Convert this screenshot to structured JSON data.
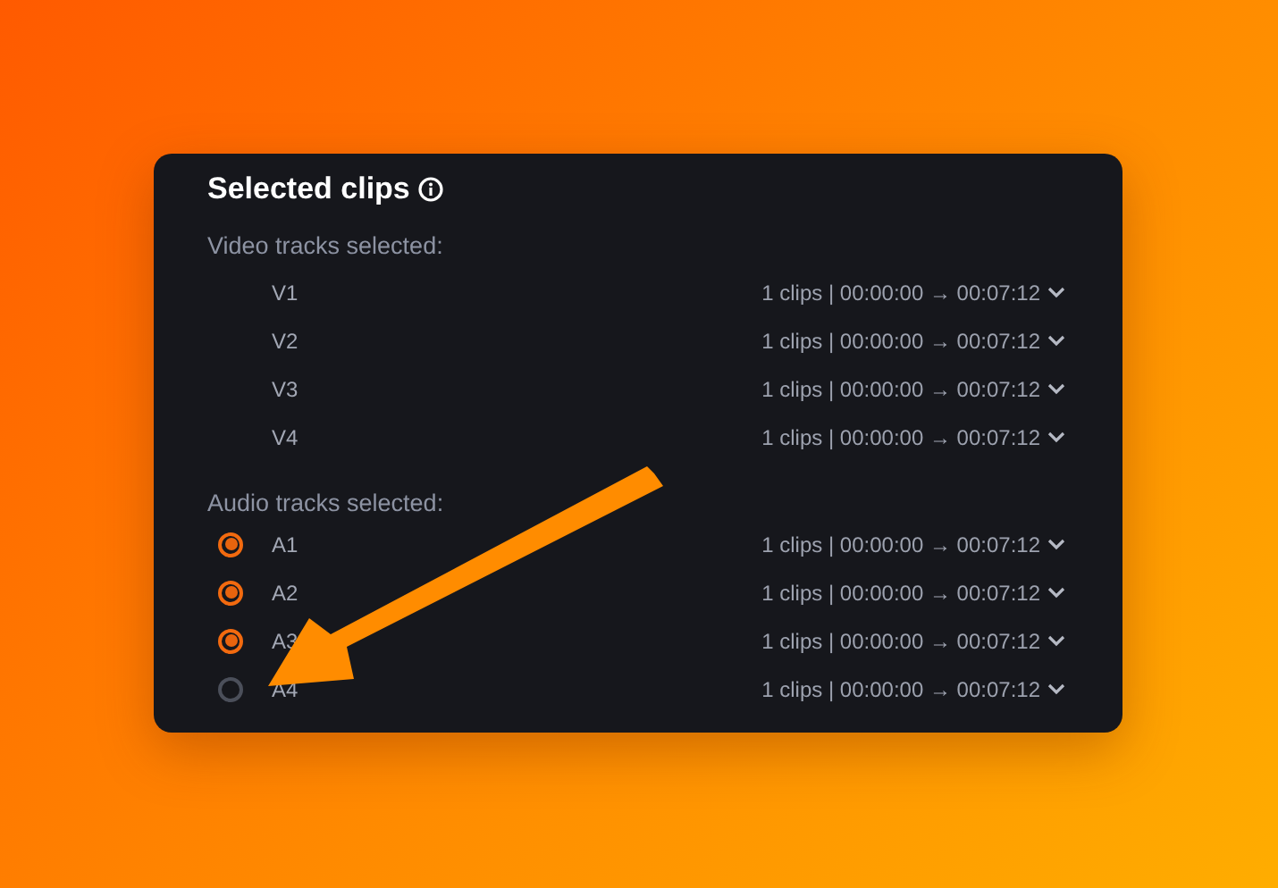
{
  "panel": {
    "title": "Selected clips",
    "video_header": "Video tracks selected:",
    "video_tracks": [
      {
        "label": "V1",
        "summary": "1 clips | 00:00:00 → 00:07:12"
      },
      {
        "label": "V2",
        "summary": "1 clips | 00:00:00 → 00:07:12"
      },
      {
        "label": "V3",
        "summary": "1 clips | 00:00:00 → 00:07:12"
      },
      {
        "label": "V4",
        "summary": "1 clips | 00:00:00 → 00:07:12"
      }
    ],
    "audio_header": "Audio tracks selected:",
    "audio_tracks": [
      {
        "label": "A1",
        "selected": true,
        "summary": "1 clips | 00:00:00 → 00:07:12"
      },
      {
        "label": "A2",
        "selected": true,
        "summary": "1 clips | 00:00:00 → 00:07:12"
      },
      {
        "label": "A3",
        "selected": true,
        "summary": "1 clips | 00:00:00 → 00:07:12"
      },
      {
        "label": "A4",
        "selected": false,
        "summary": "1 clips | 00:00:00 → 00:07:12"
      }
    ]
  }
}
